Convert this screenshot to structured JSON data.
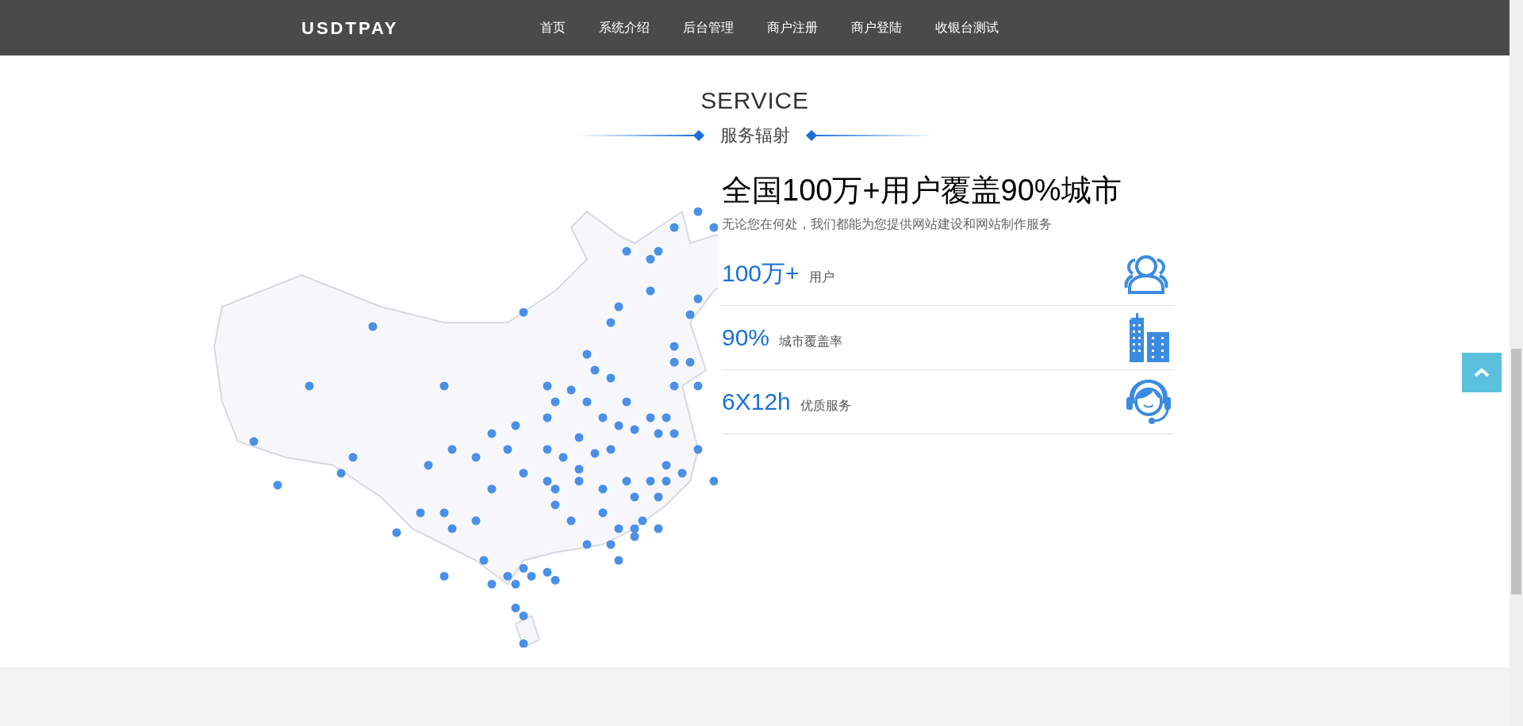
{
  "nav": {
    "logo": "USDTPAY",
    "items": [
      {
        "label": "首页",
        "selected": false
      },
      {
        "label": "系统介绍",
        "selected": false
      },
      {
        "label": "后台管理",
        "selected": false
      },
      {
        "label": "商户注册",
        "selected": false
      },
      {
        "label": "商户登陆",
        "selected": false
      },
      {
        "label": "收银台测试",
        "selected": false
      }
    ]
  },
  "section": {
    "title": "SERVICE",
    "subtitle": "服务辐射"
  },
  "coverage": {
    "heading": "全国100万+用户覆盖90%城市",
    "description": "无论您在何处，我们都能为您提供网站建设和网站制作服务",
    "stats": [
      {
        "kind": "users",
        "value": "100万+",
        "label": "用户"
      },
      {
        "kind": "buildings",
        "value": "90%",
        "label": "城市覆盖率"
      },
      {
        "kind": "support",
        "value": "6X12h",
        "label": "优质服务"
      }
    ]
  }
}
